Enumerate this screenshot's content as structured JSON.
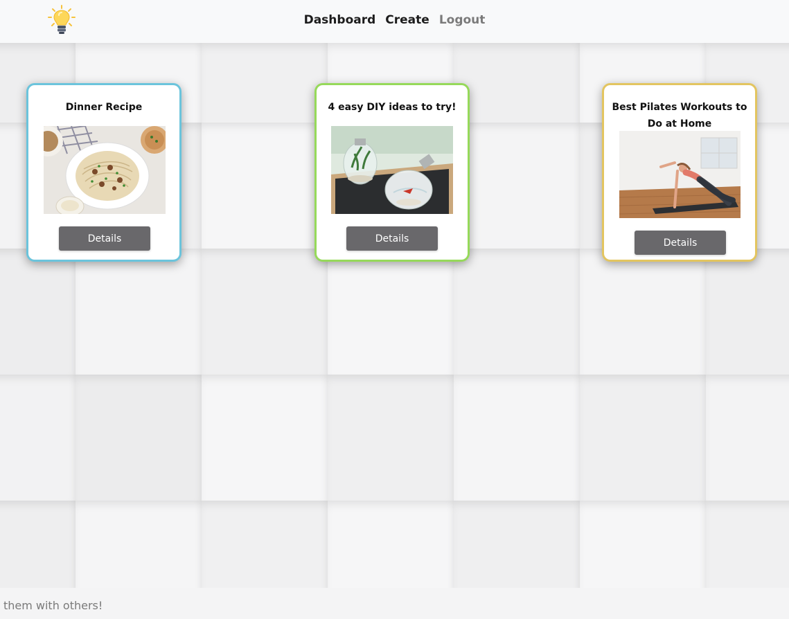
{
  "nav": {
    "logo_icon": "lightbulb-icon",
    "links": [
      "Dashboard",
      "Create",
      "Logout"
    ]
  },
  "cards": [
    {
      "title": "Dinner Recipe",
      "image": "pasta-dish-photo",
      "button": "Details",
      "border_color": "#6bc4dc"
    },
    {
      "title": "4 easy DIY ideas to try!",
      "image": "lightbulb-terrarium-photo",
      "button": "Details",
      "border_color": "#96d95a"
    },
    {
      "title": "Best Pilates Workouts to Do at Home",
      "image": "pilates-workout-photo",
      "button": "Details",
      "border_color": "#e3c560"
    }
  ],
  "footer": {
    "text": "are them with others!"
  },
  "colors": {
    "button_bg": "#69686b",
    "nav_bg": "#f8f9fa",
    "muted_link": "#7a7a7a"
  }
}
